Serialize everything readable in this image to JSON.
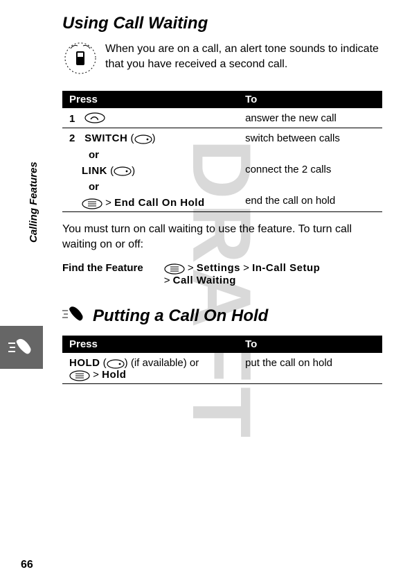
{
  "watermark": "DRAFT",
  "sidebar_label": "Calling Features",
  "page_number": "66",
  "section1": {
    "title": "Using Call Waiting",
    "intro": "When you are on a call, an alert tone sounds to indicate that you have received a second call.",
    "table": {
      "head_press": "Press",
      "head_to": "To",
      "row1": {
        "num": "1",
        "to": "answer the new call"
      },
      "row2": {
        "num": "2",
        "switch_label": "SWITCH",
        "switch_to": "switch between calls",
        "or1": "or",
        "link_label": "LINK",
        "link_to": "connect the 2 calls",
        "or2": "or",
        "end_label": "End Call On Hold",
        "end_to": "end the call on hold"
      }
    },
    "body": "You must turn on call waiting to use the feature. To turn call waiting on or off:",
    "find_label": "Find the Feature",
    "find_gt1": ">",
    "find_settings": "Settings",
    "find_gt2": ">",
    "find_incall": "In-Call Setup",
    "find_gt3": ">",
    "find_callwaiting": "Call Waiting"
  },
  "section2": {
    "title": "Putting a Call On Hold",
    "table": {
      "head_press": "Press",
      "head_to": "To",
      "hold_label": "HOLD",
      "if_avail": "(if available) or",
      "menu_gt": ">",
      "hold_menu": "Hold",
      "to": "put the call on hold"
    }
  }
}
